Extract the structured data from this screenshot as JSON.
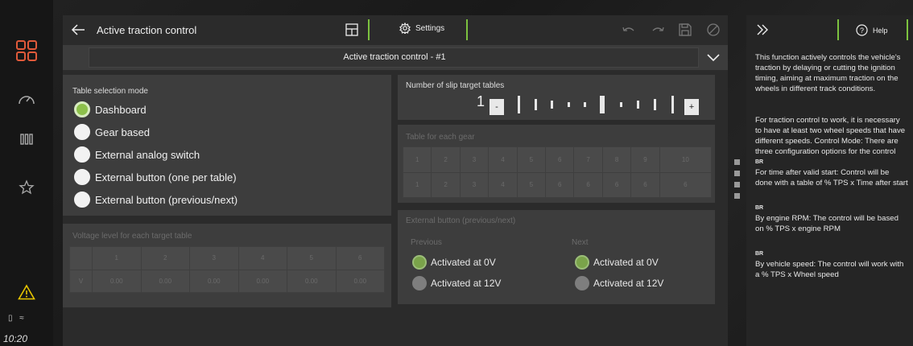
{
  "rail": {
    "time": "10:20",
    "icons": [
      "app-grid-icon",
      "dashboard-icon",
      "bars-icon",
      "star-icon",
      "warning-icon"
    ],
    "colors": {
      "accent_red": "#e05a3a",
      "accent_green": "#7cc23f",
      "warning_yellow": "#e6c400"
    }
  },
  "header": {
    "title": "Active traction control",
    "settings_label": "Settings"
  },
  "selector": {
    "value": "Active traction control - #1"
  },
  "table_selection": {
    "title": "Table selection mode",
    "options": [
      {
        "label": "Dashboard",
        "selected": true
      },
      {
        "label": "Gear based",
        "selected": false
      },
      {
        "label": "External analog switch",
        "selected": false
      },
      {
        "label": "External button (one per table)",
        "selected": false
      },
      {
        "label": "External button (previous/next)",
        "selected": false
      }
    ]
  },
  "voltage": {
    "title": "Voltage level for each target table",
    "headers": [
      "1",
      "2",
      "3",
      "4",
      "5",
      "6"
    ],
    "row_label": "V",
    "values": [
      "0.00",
      "0.00",
      "0.00",
      "0.00",
      "0.00",
      "0.00"
    ]
  },
  "slip": {
    "title": "Number of slip target tables",
    "value": "1",
    "minus": "-",
    "plus": "+"
  },
  "gear_table": {
    "title": "Table for each gear",
    "headers": [
      "1",
      "2",
      "3",
      "4",
      "5",
      "6",
      "7",
      "8",
      "9",
      "10"
    ],
    "values": [
      "1",
      "2",
      "3",
      "4",
      "5",
      "6",
      "6",
      "6",
      "6",
      "6"
    ]
  },
  "external": {
    "title": "External button (previous/next)",
    "previous_label": "Previous",
    "next_label": "Next",
    "prev_options": [
      {
        "label": "Activated at 0V",
        "selected": true
      },
      {
        "label": "Activated at 12V",
        "selected": false
      }
    ],
    "next_options": [
      {
        "label": "Activated at 0V",
        "selected": true
      },
      {
        "label": "Activated at 12V",
        "selected": false
      }
    ]
  },
  "help": {
    "button_label": "Help",
    "paragraphs": [
      "This function actively controls the vehicle's traction by delaying or cutting the ignition timing, aiming at maximum traction on the wheels in different track conditions.",
      "For traction control to work, it is necessary to have at least two wheel speeds that have different speeds. Control Mode: There are three configuration options for the control",
      "For time after valid start: Control will be done with a table of % TPS x Time after start",
      "By engine RPM: The control will be based on % TPS x engine RPM",
      "By vehicle speed: The control will work with a % TPS x Wheel speed"
    ],
    "br": "BR"
  }
}
